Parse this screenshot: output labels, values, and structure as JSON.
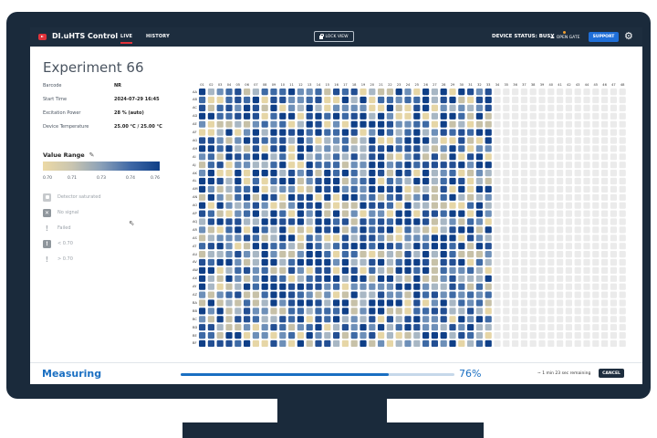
{
  "app": {
    "title": "DI.uHTS Control",
    "tabs": [
      {
        "label": "LIVE",
        "active": true
      },
      {
        "label": "HISTORY",
        "active": false
      }
    ],
    "lock_view_label": "LOCK VIEW",
    "device_status": "DEVICE STATUS: BUSY",
    "open_gate_label": "OPEN GATE",
    "support_label": "SUPPORT",
    "icons": {
      "logo": "play-logo-icon",
      "lock": "lock-icon",
      "gate": "eject-icon",
      "settings": "gear-icon"
    }
  },
  "experiment": {
    "title": "Experiment 66",
    "info": [
      {
        "label": "Barcode",
        "value": "NR"
      },
      {
        "label": "Start Time",
        "value": "2024-07-29 16:45"
      },
      {
        "label": "Excitation Power",
        "value": "28 % (auto)"
      },
      {
        "label": "Device Temperature",
        "value": "25.00 °C / 25.00 °C"
      }
    ]
  },
  "value_range": {
    "title": "Value Range",
    "ticks": [
      "0.70",
      "0.71",
      "0.73",
      "0.74",
      "0.76"
    ],
    "colors": {
      "low": "#ecd9a5",
      "high": "#0f3f87"
    }
  },
  "legend": [
    {
      "symbol": "saturated",
      "label": "Detector saturated"
    },
    {
      "symbol": "nosignal",
      "label": "No signal"
    },
    {
      "symbol": "failed",
      "label": "Failed"
    },
    {
      "symbol": "below",
      "label": "< 0.70"
    },
    {
      "symbol": "above",
      "label": "> 0.70"
    }
  ],
  "plate": {
    "columns": [
      "01",
      "02",
      "03",
      "04",
      "05",
      "06",
      "07",
      "08",
      "09",
      "10",
      "11",
      "12",
      "13",
      "14",
      "15",
      "16",
      "17",
      "18",
      "19",
      "20",
      "21",
      "22",
      "23",
      "24",
      "25",
      "26",
      "27",
      "28",
      "29",
      "30",
      "31",
      "32",
      "33",
      "34",
      "35",
      "36",
      "37",
      "38",
      "39",
      "40",
      "41",
      "42",
      "43",
      "44",
      "45",
      "46",
      "47",
      "48"
    ],
    "rows": [
      "AA",
      "AB",
      "AC",
      "AD",
      "AE",
      "AF",
      "AG",
      "AH",
      "AI",
      "AJ",
      "AK",
      "AL",
      "AM",
      "AN",
      "AO",
      "AP",
      "AQ",
      "AR",
      "AS",
      "AT",
      "AU",
      "AV",
      "AW",
      "AX",
      "AY",
      "AZ",
      "BA",
      "BB",
      "BC",
      "BD",
      "BE",
      "BF"
    ],
    "measured_columns": 33,
    "palette": [
      "#0f3f87",
      "#234f93",
      "#3e6aa5",
      "#6d8fb8",
      "#a8b7c4",
      "#c7c1a8",
      "#e6d6a6"
    ],
    "empty_color": "#ebebeb"
  },
  "footer": {
    "status": "Measuring",
    "progress": 76,
    "progress_label": "76%",
    "remaining": "~ 1 min 23 sec remaining",
    "cancel_label": "CANCEL"
  }
}
